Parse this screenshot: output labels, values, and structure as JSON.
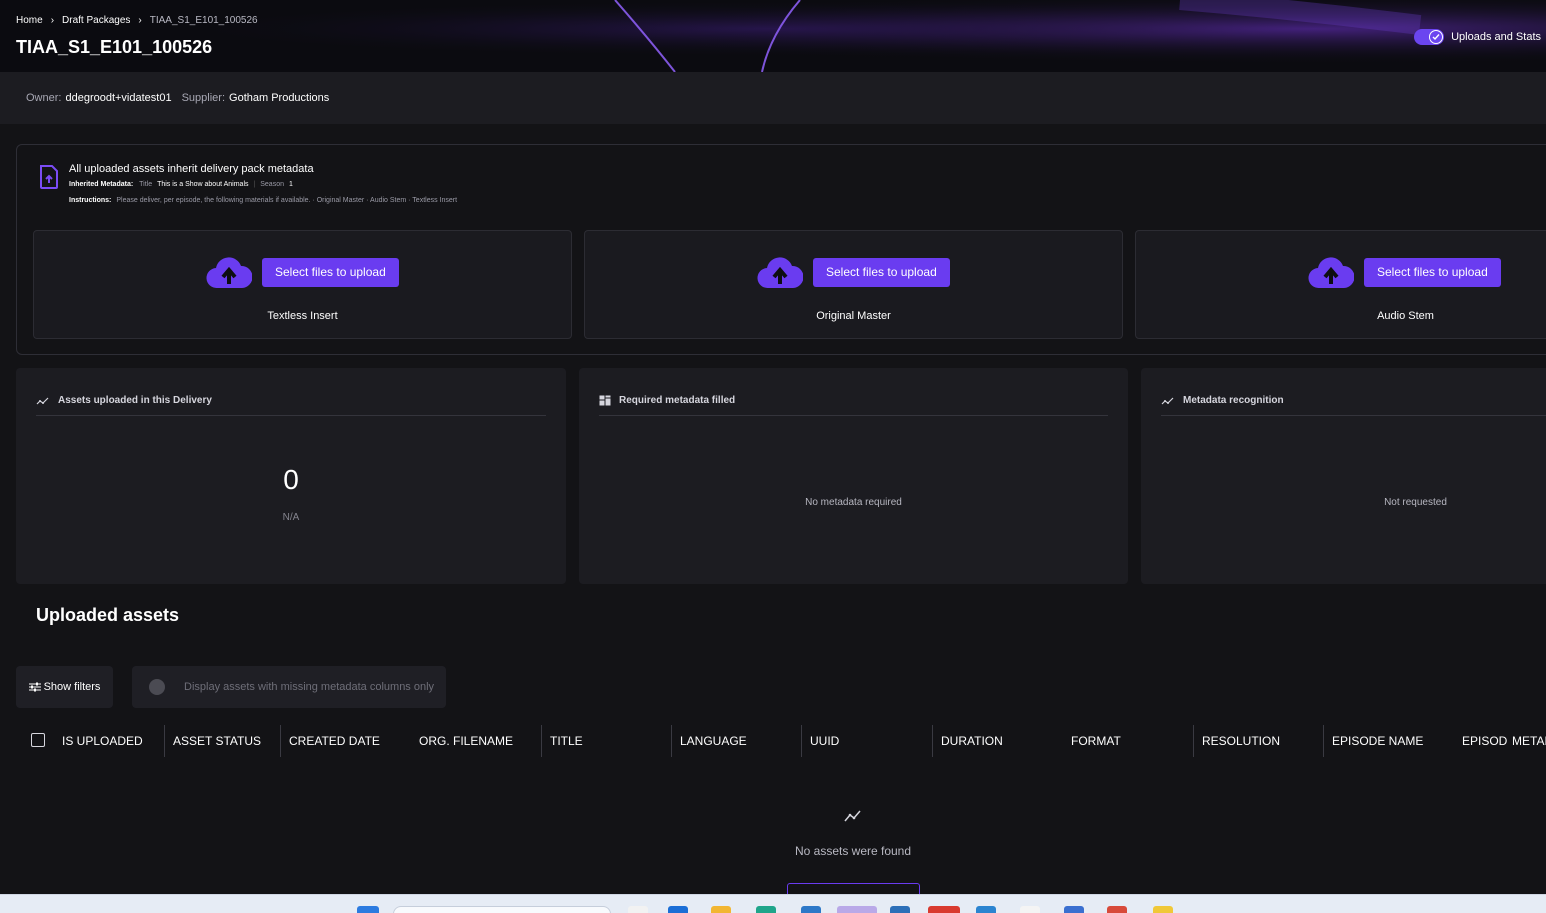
{
  "breadcrumb": {
    "items": [
      "Home",
      "Draft Packages",
      "TIAA_S1_E101_100526"
    ]
  },
  "page_title": "TIAA_S1_E101_100526",
  "header_toggle": {
    "label": "Uploads and Stats",
    "enabled": true
  },
  "owner_bar": {
    "owner_label": "Owner:",
    "owner_value": "ddegroodt+vidatest01",
    "supplier_label": "Supplier:",
    "supplier_value": "Gotham Productions"
  },
  "upload_info": {
    "title": "All uploaded assets inherit delivery pack metadata",
    "inherited_label": "Inherited Metadata:",
    "title_key": "Title",
    "title_value": "This is a Show about Animals",
    "season_key": "Season",
    "season_value": "1",
    "instructions_label": "Instructions:",
    "instructions_text": "Please deliver, per episode, the following materials if available. · Original Master · Audio Stem · Textless Insert"
  },
  "upload_slots": [
    {
      "button": "Select files to upload",
      "label": "Textless Insert"
    },
    {
      "button": "Select files to upload",
      "label": "Original Master"
    },
    {
      "button": "Select files to upload",
      "label": "Audio Stem"
    }
  ],
  "stats": {
    "assets_uploaded": {
      "title": "Assets uploaded in this Delivery",
      "value": "0",
      "sub": "N/A",
      "icon": "trend-icon"
    },
    "required_metadata": {
      "title": "Required metadata filled",
      "message": "No metadata required",
      "icon": "dashboard-icon"
    },
    "metadata_recognition": {
      "title": "Metadata recognition",
      "message": "Not requested",
      "icon": "trend-icon"
    }
  },
  "uploaded_assets": {
    "title": "Uploaded assets",
    "show_filters": "Show filters",
    "missing_toggle_label": "Display assets with missing metadata columns only",
    "columns": [
      "IS UPLOADED",
      "ASSET STATUS",
      "CREATED DATE",
      "ORG. FILENAME",
      "TITLE",
      "LANGUAGE",
      "UUID",
      "DURATION",
      "FORMAT",
      "RESOLUTION",
      "EPISODE NAME",
      "EPISOD",
      "METAD"
    ],
    "empty_message": "No assets were found"
  },
  "colors": {
    "accent": "#6a3cf0",
    "background": "#131316",
    "card": "#1c1c21"
  }
}
